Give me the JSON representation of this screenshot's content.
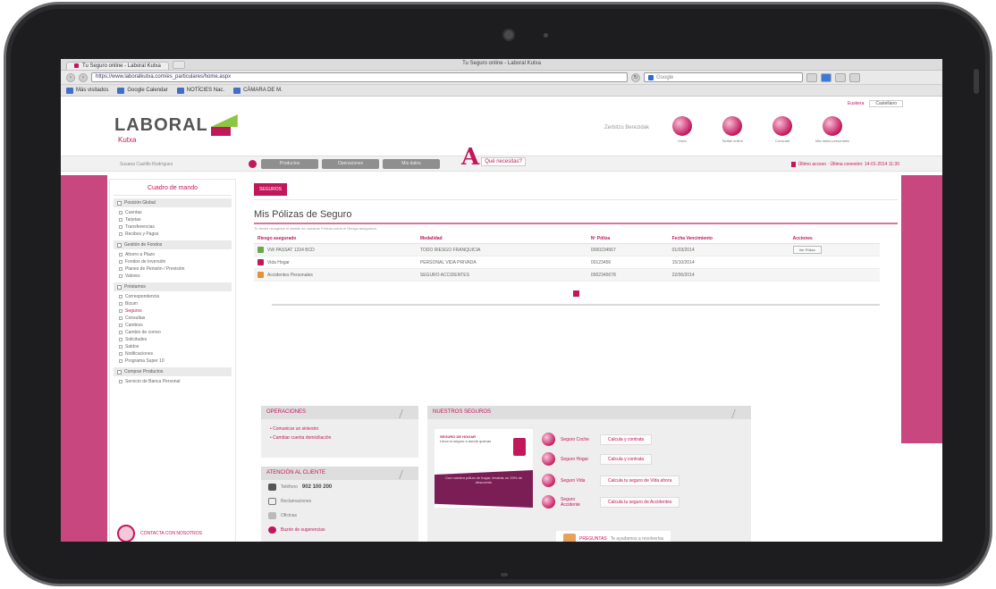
{
  "browser": {
    "window_title": "Tu Seguro online - Laboral Kutxa",
    "tab_label": "Tu Seguro online - Laboral Kutxa",
    "url": "https://www.laboralkutxa.com/es_particulares/home.aspx",
    "search_placeholder": "Google",
    "bookmarks": [
      "Más visitados",
      "Google Calendar",
      "NOTÍCIES Nac.",
      "CÀMARA DE M."
    ]
  },
  "header": {
    "top_links": [
      "Euskera",
      "Castellano"
    ],
    "logo_main": "LABORAL",
    "logo_sub": "Kutxa",
    "greeting": "Zerbitzu Berezidak",
    "icons": [
      {
        "label": "Inicio",
        "icon": "home-icon"
      },
      {
        "label": "Tarifas online",
        "icon": "rate-icon"
      },
      {
        "label": "Consulta",
        "icon": "query-icon"
      },
      {
        "label": "Mis datos personales",
        "icon": "profile-icon"
      }
    ]
  },
  "nav": {
    "user": "Susana Castillo Rodríguez",
    "tabs": [
      "Productos",
      "Operaciones",
      "Mis datos"
    ],
    "brand_text": "Qué necesitas?",
    "session": "Último acceso · Última conexión: 14-01-2014 11:30"
  },
  "sidebar": {
    "title": "Cuadro de mando",
    "sections": [
      {
        "label": "Posición Global",
        "items": [
          "Cuentas",
          "Tarjetas",
          "Transferencias",
          "Recibos y Pagos"
        ]
      },
      {
        "label": "Gestión de Fondos",
        "items": [
          "Ahorro a Plazo",
          "Fondos de Inversión",
          "Planes de Pensión / Previsión",
          "Valores"
        ]
      },
      {
        "label": "Préstamos",
        "items": [
          "Correspondencia",
          "Bizum",
          "Seguros",
          "Consultas",
          "Cambios",
          "Cambio de correo",
          "Solicitudes",
          "Saldos",
          "Notificaciones",
          "Programa Super 10"
        ]
      },
      {
        "label": "Comprar Productos",
        "items": [
          "Servicio de Banca Personal"
        ]
      }
    ],
    "highlight_item": "Seguros",
    "footer_label": "CONTACTA CON NOSOTROS"
  },
  "main": {
    "breadcrumb": "SEGUROS",
    "title": "Mis Pólizas de Seguro",
    "intro": "Tu tienes recogidos el detalle de nuestras Pólizas sobre el Riesgo asegurado.",
    "columns": [
      "Riesgo asegurado",
      "Modalidad",
      "Nº Póliza",
      "Fecha Vencimiento",
      "Acciones"
    ],
    "rows": [
      {
        "riesgo": "VW PASSAT 1234 BCD",
        "modalidad": "TODO RIESGO FRANQUICIA",
        "poliza": "0000234567",
        "fecha": "01/03/2014",
        "accion": "Ver Póliza",
        "color": "#6aa84f"
      },
      {
        "riesgo": "Vida Hogar",
        "modalidad": "PERSONAL VIDA PRIVADA",
        "poliza": "00123456",
        "fecha": "15/10/2014",
        "accion": "",
        "color": "#c2185b"
      },
      {
        "riesgo": "Accidentes Personales",
        "modalidad": "SEGURO ACCIDENTES",
        "poliza": "0002345678",
        "fecha": "22/06/2014",
        "accion": "",
        "color": "#e69138"
      }
    ]
  },
  "operations": {
    "title": "OPERACIONES",
    "links": [
      "Comunicar un siniestro",
      "Cambiar cuenta domiciliación"
    ]
  },
  "support": {
    "title": "ATENCIÓN AL CLIENTE",
    "phone_label": "Teléfono",
    "phone": "902 100 200",
    "items": [
      {
        "label": "Reclamaciones",
        "icon": "chat-icon"
      },
      {
        "label": "Oficinas",
        "icon": "location-icon"
      },
      {
        "label": "Buzón de sugerencias",
        "icon": "mail-icon"
      }
    ]
  },
  "insurance": {
    "title": "NUESTROS SEGUROS",
    "promo_head": "SEGURO DE HOGAR",
    "promo_sub": "Lleva tu seguro a donde quieras",
    "promo_band": "Con nuestra póliza de hogar, tendrás un 20% de descuento",
    "products": [
      {
        "name": "Seguro Coche",
        "cta": "Calcula y contrata"
      },
      {
        "name": "Seguro Hogar",
        "cta": "Calcula y contrata"
      },
      {
        "name": "Seguro Vida",
        "cta": "Calcula tu seguro de Vida ahora"
      },
      {
        "name": "Seguro Accidente",
        "cta": "Calcula tu seguro de Accidentes"
      }
    ],
    "faq": "PREGUNTAS",
    "faq_sub": "Te ayudamos a resolverlas"
  }
}
